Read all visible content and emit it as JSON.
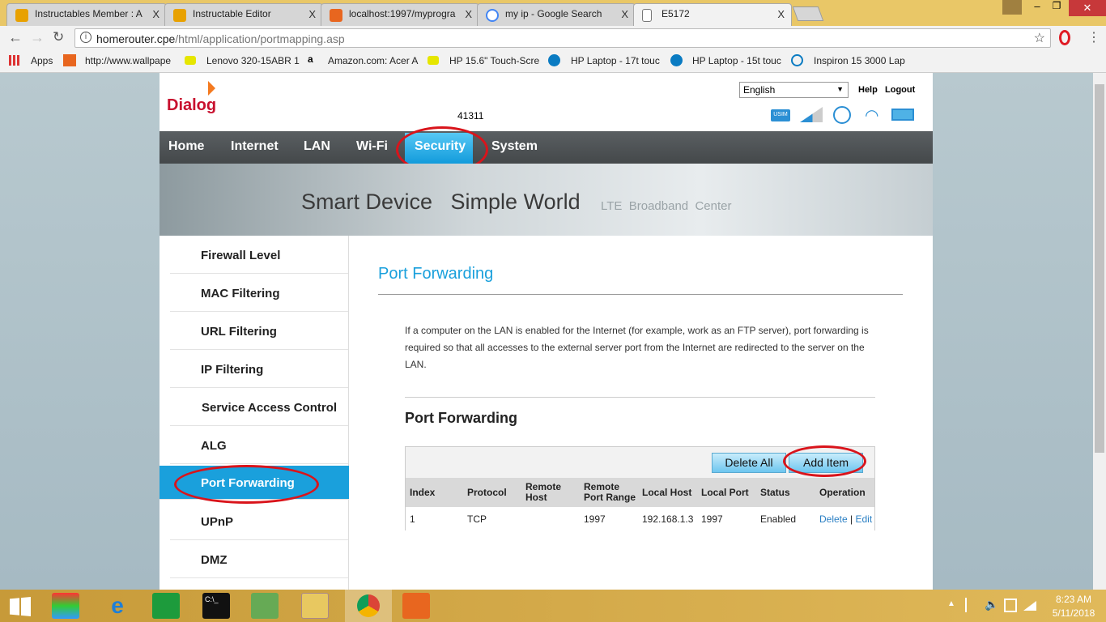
{
  "browser": {
    "tabs": [
      {
        "title": "Instructables Member : A",
        "color": "#e8a100"
      },
      {
        "title": "Instructable Editor",
        "color": "#e8a100"
      },
      {
        "title": "localhost:1997/myprogra",
        "color": "#e8661f"
      },
      {
        "title": "my ip - Google Search",
        "color": "#4285f4"
      },
      {
        "title": "E5172",
        "color": "#ffffff"
      }
    ],
    "close_glyph": "X",
    "url_host": "homerouter.cpe",
    "url_path": "/html/application/portmapping.asp",
    "bookmarks": [
      "Apps",
      "http://www.wallpape",
      "Lenovo 320-15ABR 1",
      "Amazon.com: Acer A",
      "HP 15.6\" Touch-Scre",
      "HP Laptop - 17t touc",
      "HP Laptop - 15t touc",
      "Inspiron 15 3000 Lap"
    ]
  },
  "router": {
    "logo": "Dialog",
    "language": "English",
    "help": "Help",
    "logout": "Logout",
    "code": "41311",
    "status_icons": [
      "usim-icon",
      "signal-icon",
      "internet-globe-icon",
      "wifi-icon",
      "battery-icon"
    ],
    "nav": [
      "Home",
      "Internet",
      "LAN",
      "Wi-Fi",
      "Security",
      "System"
    ],
    "active_nav": "Security",
    "banner": {
      "main": "Smart Device   Simple World",
      "sub": "LTE  Broadband  Center"
    },
    "sidebar": [
      "Firewall Level",
      "MAC Filtering",
      "URL Filtering",
      "IP Filtering",
      "Service Access Control",
      "ALG",
      "Port Forwarding",
      "UPnP",
      "DMZ"
    ],
    "active_side": "Port Forwarding",
    "page_title": "Port Forwarding",
    "description": "If a computer on the LAN is enabled for the Internet (for example, work as an FTP server), port forwarding is required so that all accesses to the external server port from the Internet are redirected to the server on the LAN.",
    "section_title": "Port Forwarding",
    "delete_all": "Delete All",
    "add_item": "Add Item",
    "table": {
      "headers": [
        "Index",
        "Protocol",
        "Remote Host",
        "Remote Port Range",
        "Local Host",
        "Local Port",
        "Status",
        "Operation"
      ],
      "rows": [
        {
          "index": "1",
          "protocol": "TCP",
          "remote_host": "",
          "remote_port_range": "1997",
          "local_host": "192.168.1.3",
          "local_port": "1997",
          "status": "Enabled",
          "delete": "Delete",
          "sep": "|",
          "edit": "Edit"
        }
      ]
    },
    "accent": "#1aa0dc",
    "highlight_color": "#d9141b"
  },
  "taskbar": {
    "time": "8:23 AM",
    "date": "5/11/2018"
  }
}
